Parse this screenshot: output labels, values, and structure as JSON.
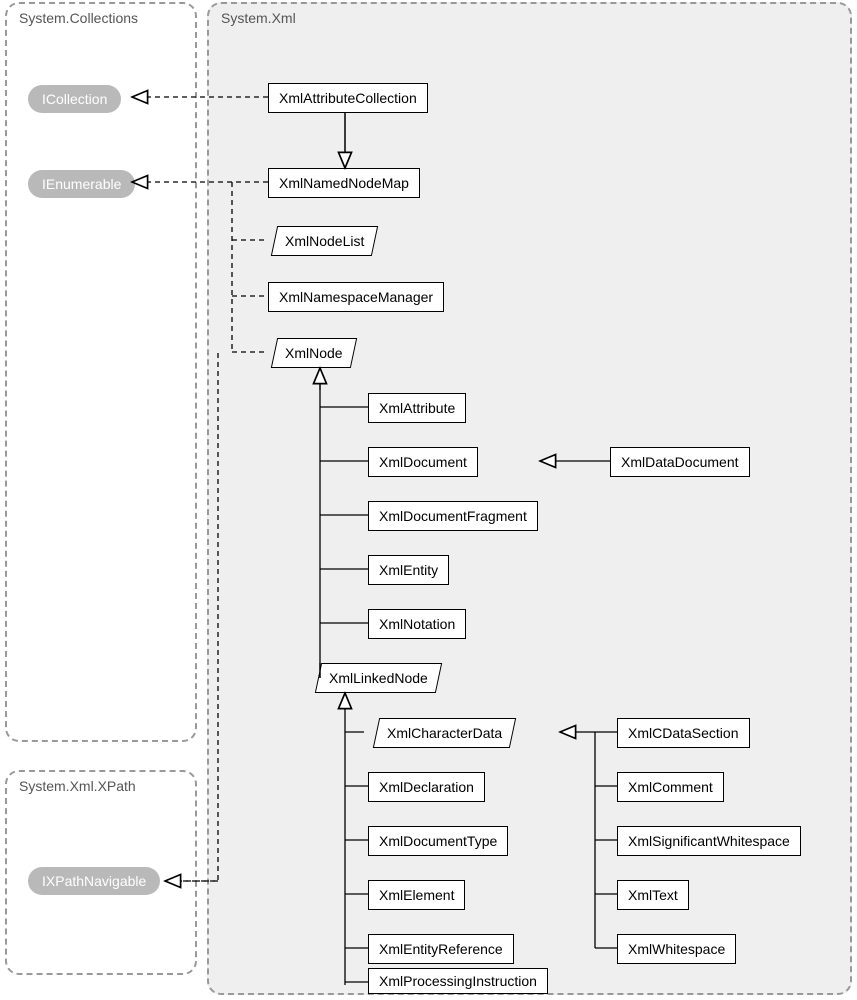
{
  "namespaces": {
    "collections": "System.Collections",
    "xml": "System.Xml",
    "xpath": "System.Xml.XPath"
  },
  "interfaces": {
    "icollection": "ICollection",
    "ienumerable": "IEnumerable",
    "ixpathnavigable": "IXPathNavigable"
  },
  "classes": {
    "xmlAttributeCollection": "XmlAttributeCollection",
    "xmlNamedNodeMap": "XmlNamedNodeMap",
    "xmlNodeList": "XmlNodeList",
    "xmlNamespaceManager": "XmlNamespaceManager",
    "xmlNode": "XmlNode",
    "xmlAttribute": "XmlAttribute",
    "xmlDocument": "XmlDocument",
    "xmlDataDocument": "XmlDataDocument",
    "xmlDocumentFragment": "XmlDocumentFragment",
    "xmlEntity": "XmlEntity",
    "xmlNotation": "XmlNotation",
    "xmlLinkedNode": "XmlLinkedNode",
    "xmlCharacterData": "XmlCharacterData",
    "xmlDeclaration": "XmlDeclaration",
    "xmlDocumentType": "XmlDocumentType",
    "xmlElement": "XmlElement",
    "xmlEntityReference": "XmlEntityReference",
    "xmlProcessingInstruction": "XmlProcessingInstruction",
    "xmlCDataSection": "XmlCDataSection",
    "xmlComment": "XmlComment",
    "xmlSignificantWhitespace": "XmlSignificantWhitespace",
    "xmlText": "XmlText",
    "xmlWhitespace": "XmlWhitespace"
  }
}
